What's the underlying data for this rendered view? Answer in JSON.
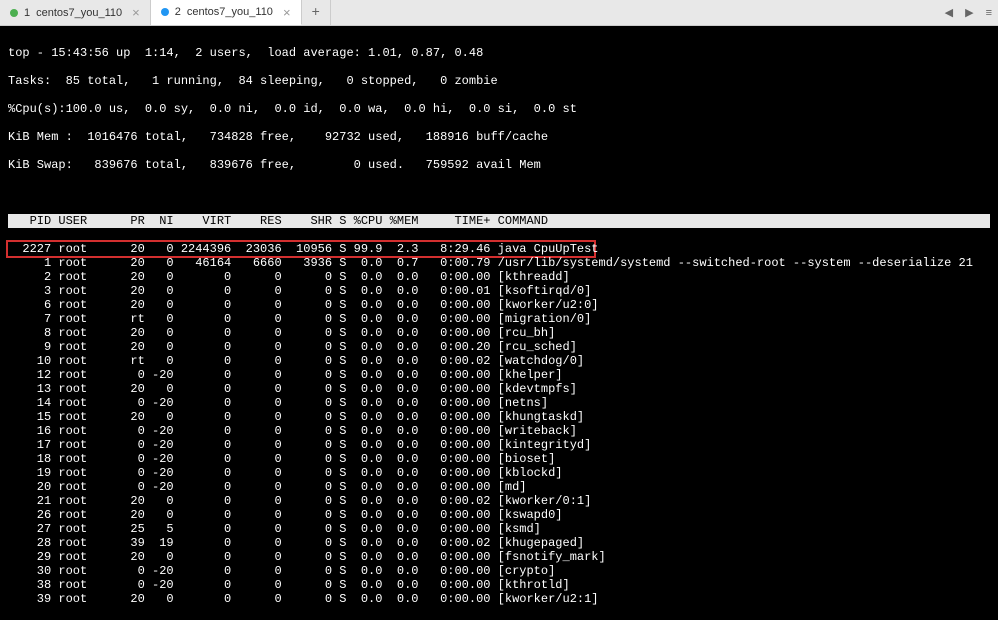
{
  "tabs": {
    "tab1": {
      "num": "1",
      "label": "centos7_you_110"
    },
    "tab2": {
      "num": "2",
      "label": "centos7_you_110"
    },
    "add": "+",
    "nav_left": "◀",
    "nav_right": "▶",
    "nav_menu": "≡"
  },
  "summary": {
    "line1": "top - 15:43:56 up  1:14,  2 users,  load average: 1.01, 0.87, 0.48",
    "line2": "Tasks:  85 total,   1 running,  84 sleeping,   0 stopped,   0 zombie",
    "line3": "%Cpu(s):100.0 us,  0.0 sy,  0.0 ni,  0.0 id,  0.0 wa,  0.0 hi,  0.0 si,  0.0 st",
    "line4": "KiB Mem :  1016476 total,   734828 free,    92732 used,   188916 buff/cache",
    "line5": "KiB Swap:   839676 total,   839676 free,        0 used.   759592 avail Mem"
  },
  "columns": "   PID USER      PR  NI    VIRT    RES    SHR S %CPU %MEM     TIME+ COMMAND                                                                        ",
  "highlighted": "  2227 root      20   0 2244396  23036  10956 S 99.9  2.3   8:29.46 java CpuUpTest",
  "rows": [
    "     1 root      20   0   46164   6660   3936 S  0.0  0.7   0:00.79 /usr/lib/systemd/systemd --switched-root --system --deserialize 21",
    "     2 root      20   0       0      0      0 S  0.0  0.0   0:00.00 [kthreadd]",
    "     3 root      20   0       0      0      0 S  0.0  0.0   0:00.01 [ksoftirqd/0]",
    "     6 root      20   0       0      0      0 S  0.0  0.0   0:00.00 [kworker/u2:0]",
    "     7 root      rt   0       0      0      0 S  0.0  0.0   0:00.00 [migration/0]",
    "     8 root      20   0       0      0      0 S  0.0  0.0   0:00.00 [rcu_bh]",
    "     9 root      20   0       0      0      0 S  0.0  0.0   0:00.20 [rcu_sched]",
    "    10 root      rt   0       0      0      0 S  0.0  0.0   0:00.02 [watchdog/0]",
    "    12 root       0 -20       0      0      0 S  0.0  0.0   0:00.00 [khelper]",
    "    13 root      20   0       0      0      0 S  0.0  0.0   0:00.00 [kdevtmpfs]",
    "    14 root       0 -20       0      0      0 S  0.0  0.0   0:00.00 [netns]",
    "    15 root      20   0       0      0      0 S  0.0  0.0   0:00.00 [khungtaskd]",
    "    16 root       0 -20       0      0      0 S  0.0  0.0   0:00.00 [writeback]",
    "    17 root       0 -20       0      0      0 S  0.0  0.0   0:00.00 [kintegrityd]",
    "    18 root       0 -20       0      0      0 S  0.0  0.0   0:00.00 [bioset]",
    "    19 root       0 -20       0      0      0 S  0.0  0.0   0:00.00 [kblockd]",
    "    20 root       0 -20       0      0      0 S  0.0  0.0   0:00.00 [md]",
    "    21 root      20   0       0      0      0 S  0.0  0.0   0:00.02 [kworker/0:1]",
    "    26 root      20   0       0      0      0 S  0.0  0.0   0:00.00 [kswapd0]",
    "    27 root      25   5       0      0      0 S  0.0  0.0   0:00.00 [ksmd]",
    "    28 root      39  19       0      0      0 S  0.0  0.0   0:00.02 [khugepaged]",
    "    29 root      20   0       0      0      0 S  0.0  0.0   0:00.00 [fsnotify_mark]",
    "    30 root       0 -20       0      0      0 S  0.0  0.0   0:00.00 [crypto]",
    "    38 root       0 -20       0      0      0 S  0.0  0.0   0:00.00 [kthrotld]",
    "    39 root      20   0       0      0      0 S  0.0  0.0   0:00.00 [kworker/u2:1]"
  ]
}
